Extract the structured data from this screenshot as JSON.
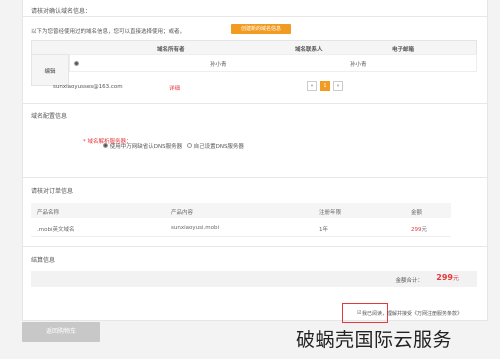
{
  "verify_section": {
    "title": "请核对确认域名信息："
  },
  "registrant": {
    "intro": "以下为您曾经使用过的域名信息，您可以直接选择使用；或者，",
    "create_button": "创建新的域名信息",
    "columns": [
      "域名所有者",
      "域名联系人",
      "电子邮箱"
    ],
    "edit_label": "编辑",
    "row": {
      "owner": "孙小青",
      "contact": "孙小青"
    },
    "email": "sunxiaoyusses@163.com",
    "detail_link": "详细"
  },
  "pager": {
    "prev": "«",
    "current": "1",
    "next": "»"
  },
  "dns_section": {
    "title": "域名配置信息",
    "label": "* 域名解析服务器：",
    "option_selected": "使用中万网缺省认DNS服务器",
    "option_other": "自己设置DNS服务器"
  },
  "order_section": {
    "title": "请核对订单信息",
    "columns": [
      "产品名称",
      "产品内容",
      "注册年限",
      "金额"
    ],
    "row": {
      "product": ".mobi英文域名",
      "content": "sunxiaoyusi.mobi",
      "years": "1年",
      "amount": "299",
      "amount_unit": "元"
    }
  },
  "settlement": {
    "title": "结算信息",
    "total_label": "金额合计：",
    "total_value": "299",
    "total_unit": "元"
  },
  "agreement": {
    "text": "我已阅读，理解并接受《万网注册服务条款》"
  },
  "back_button": "返回购物车",
  "watermark": "破蜗壳国际云服务"
}
